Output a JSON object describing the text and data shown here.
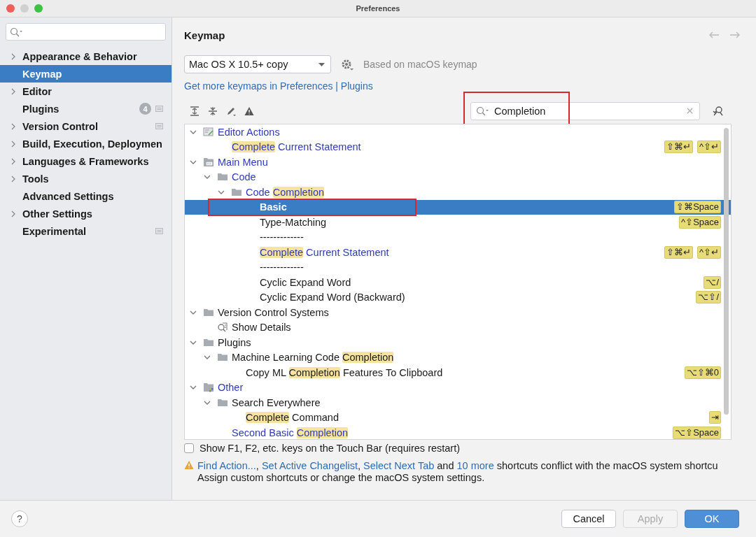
{
  "window": {
    "title": "Preferences"
  },
  "sidebar": {
    "items": [
      {
        "label": "Appearance & Behavior",
        "expandable": true,
        "selected": false,
        "project_scope": false
      },
      {
        "label": "Keymap",
        "expandable": false,
        "selected": true,
        "project_scope": false
      },
      {
        "label": "Editor",
        "expandable": true,
        "selected": false,
        "project_scope": false
      },
      {
        "label": "Plugins",
        "expandable": false,
        "selected": false,
        "badge": "4",
        "project_scope": true
      },
      {
        "label": "Version Control",
        "expandable": true,
        "selected": false,
        "project_scope": true
      },
      {
        "label": "Build, Execution, Deploymen",
        "expandable": true,
        "selected": false,
        "project_scope": false
      },
      {
        "label": "Languages & Frameworks",
        "expandable": true,
        "selected": false,
        "project_scope": false
      },
      {
        "label": "Tools",
        "expandable": true,
        "selected": false,
        "project_scope": false
      },
      {
        "label": "Advanced Settings",
        "expandable": false,
        "selected": false,
        "project_scope": false
      },
      {
        "label": "Other Settings",
        "expandable": true,
        "selected": false,
        "project_scope": false
      },
      {
        "label": "Experimental",
        "expandable": false,
        "selected": false,
        "project_scope": true
      }
    ]
  },
  "panel": {
    "title": "Keymap",
    "keymap": {
      "value": "Mac OS X 10.5+ copy"
    },
    "based_on": "Based on macOS keymap",
    "more_link": "Get more keymaps in Preferences | Plugins",
    "search": {
      "value": "Completion",
      "highlighted": true
    },
    "tree": [
      {
        "kind": "editor_actions",
        "parts": [
          {
            "text": "Editor Actions",
            "match": false
          }
        ],
        "modified": true,
        "selected": false,
        "expanded": true,
        "children": [
          {
            "kind": "action",
            "parts": [
              {
                "text": "Complete",
                "match": true
              },
              {
                "text": " Current Statement",
                "match": false
              }
            ],
            "modified": true,
            "selected": false,
            "shortcuts": [
              "⇧⌘↵",
              "^⇧↵"
            ]
          }
        ]
      },
      {
        "kind": "main_menu",
        "parts": [
          {
            "text": "Main Menu",
            "match": false
          }
        ],
        "modified": true,
        "selected": false,
        "expanded": true,
        "children": [
          {
            "kind": "folder",
            "parts": [
              {
                "text": "Code",
                "match": false
              }
            ],
            "modified": true,
            "selected": false,
            "expanded": true,
            "children": [
              {
                "kind": "folder",
                "parts": [
                  {
                    "text": "Code ",
                    "match": false
                  },
                  {
                    "text": "Completion",
                    "match": true
                  }
                ],
                "modified": true,
                "selected": false,
                "expanded": true,
                "children": [
                  {
                    "kind": "action",
                    "parts": [
                      {
                        "text": "Basic",
                        "match": false
                      }
                    ],
                    "modified": false,
                    "selected": true,
                    "outlined": true,
                    "shortcuts": [
                      "⇧⌘Space"
                    ]
                  },
                  {
                    "kind": "action",
                    "parts": [
                      {
                        "text": "Type-Matching",
                        "match": false
                      }
                    ],
                    "modified": false,
                    "selected": false,
                    "shortcuts": [
                      "^⇧Space"
                    ]
                  },
                  {
                    "kind": "action",
                    "parts": [
                      {
                        "text": "-------------",
                        "match": false
                      }
                    ],
                    "modified": false,
                    "selected": false
                  },
                  {
                    "kind": "action",
                    "parts": [
                      {
                        "text": "Complete",
                        "match": true
                      },
                      {
                        "text": " Current Statement",
                        "match": false
                      }
                    ],
                    "modified": true,
                    "selected": false,
                    "shortcuts": [
                      "⇧⌘↵",
                      "^⇧↵"
                    ]
                  },
                  {
                    "kind": "action",
                    "parts": [
                      {
                        "text": "-------------",
                        "match": false
                      }
                    ],
                    "modified": false,
                    "selected": false
                  },
                  {
                    "kind": "action",
                    "parts": [
                      {
                        "text": "Cyclic Expand Word",
                        "match": false
                      }
                    ],
                    "modified": false,
                    "selected": false,
                    "shortcuts": [
                      "⌥/"
                    ]
                  },
                  {
                    "kind": "action",
                    "parts": [
                      {
                        "text": "Cyclic Expand Word (Backward)",
                        "match": false
                      }
                    ],
                    "modified": false,
                    "selected": false,
                    "shortcuts": [
                      "⌥⇧/"
                    ]
                  }
                ]
              }
            ]
          }
        ]
      },
      {
        "kind": "folder",
        "parts": [
          {
            "text": "Version Control Systems",
            "match": false
          }
        ],
        "modified": false,
        "selected": false,
        "expanded": true,
        "children": [
          {
            "kind": "show_details",
            "parts": [
              {
                "text": "Show Details",
                "match": false
              }
            ],
            "modified": false,
            "selected": false
          }
        ]
      },
      {
        "kind": "folder",
        "parts": [
          {
            "text": "Plugins",
            "match": false
          }
        ],
        "modified": false,
        "selected": false,
        "expanded": true,
        "children": [
          {
            "kind": "folder",
            "parts": [
              {
                "text": "Machine Learning Code ",
                "match": false
              },
              {
                "text": "Completion",
                "match": true
              }
            ],
            "modified": false,
            "selected": false,
            "expanded": true,
            "children": [
              {
                "kind": "action",
                "parts": [
                  {
                    "text": "Copy ML ",
                    "match": false
                  },
                  {
                    "text": "Completion",
                    "match": true
                  },
                  {
                    "text": " Features To Clipboard",
                    "match": false
                  }
                ],
                "modified": false,
                "selected": false,
                "shortcuts": [
                  "⌥⇧⌘0"
                ]
              }
            ]
          }
        ]
      },
      {
        "kind": "other",
        "parts": [
          {
            "text": "Other",
            "match": false
          }
        ],
        "modified": true,
        "selected": false,
        "expanded": true,
        "children": [
          {
            "kind": "folder",
            "parts": [
              {
                "text": "Search Everywhere",
                "match": false
              }
            ],
            "modified": false,
            "selected": false,
            "expanded": true,
            "children": [
              {
                "kind": "action",
                "parts": [
                  {
                    "text": "Complete",
                    "match": true
                  },
                  {
                    "text": " Command",
                    "match": false
                  }
                ],
                "modified": false,
                "selected": false,
                "shortcuts": [
                  "⇥"
                ]
              }
            ]
          },
          {
            "kind": "action",
            "parts": [
              {
                "text": "Second Basic ",
                "match": false
              },
              {
                "text": "Completion",
                "match": true
              }
            ],
            "modified": true,
            "selected": false,
            "shortcuts": [
              "⌥⇧Space"
            ]
          }
        ]
      }
    ],
    "touch_bar": {
      "label": "Show F1, F2, etc. keys on the Touch Bar (requires restart)",
      "checked": false
    },
    "conflict": {
      "parts": [
        {
          "text": "Find Action...",
          "link": true
        },
        {
          "text": ", ",
          "link": false
        },
        {
          "text": "Set Active Changelist",
          "link": true
        },
        {
          "text": ", ",
          "link": false
        },
        {
          "text": "Select Next Tab",
          "link": true
        },
        {
          "text": " and ",
          "link": false
        },
        {
          "text": "10 more",
          "link": true
        },
        {
          "text": " shortcuts conflict with the macOS system shortcu",
          "link": false
        }
      ],
      "hint": "Assign custom shortcuts or change the macOS system settings."
    }
  },
  "footer": {
    "help": "?",
    "buttons": [
      {
        "label": "Cancel",
        "kind": "normal",
        "disabled": false
      },
      {
        "label": "Apply",
        "kind": "normal",
        "disabled": true
      },
      {
        "label": "OK",
        "kind": "default",
        "disabled": false
      }
    ]
  }
}
